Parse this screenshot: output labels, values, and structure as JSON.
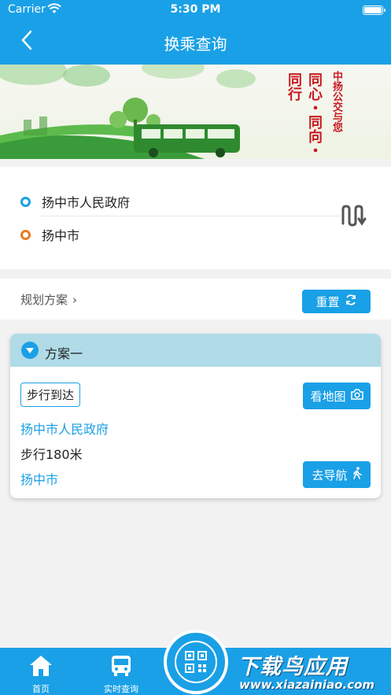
{
  "status_bar": {
    "carrier": "Carrier",
    "time": "5:30 PM"
  },
  "navbar": {
    "back_icon": "chevron-left-icon",
    "title": "换乘查询"
  },
  "banner": {
    "slogan_top": "中扬公交与您",
    "slogan_left": "同心・同向・同行"
  },
  "route": {
    "from": "扬中市人民政府",
    "to": "扬中市",
    "swap_icon": "swap-icon",
    "from_color": "#1aa0e6",
    "to_color": "#e97b22"
  },
  "plan_bar": {
    "link_label": "规划方案",
    "reset_label": "重置"
  },
  "scheme": {
    "title": "方案一",
    "tag": "步行到达",
    "start": "扬中市人民政府",
    "distance": "步行180米",
    "end": "扬中市",
    "map_label": "看地图",
    "navigate_label": "去导航"
  },
  "tabbar": {
    "home_label": "首页",
    "realtime_label": "实时查询",
    "qr_icon": "qr-code-icon"
  },
  "watermark": {
    "big": "下载鸟应用",
    "small": "www.xiazainiao.com"
  },
  "colors": {
    "primary": "#1aa0e6",
    "scheme_header": "#b0dbe7"
  }
}
